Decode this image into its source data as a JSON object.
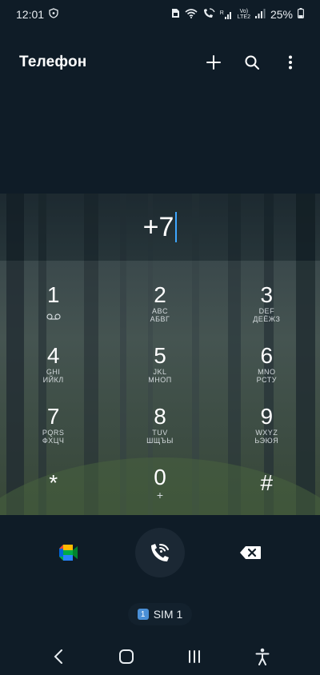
{
  "status": {
    "time": "12:01",
    "battery": "25%",
    "volte_top": "Vo)",
    "volte_bottom": "LTE2",
    "r_label": "R"
  },
  "app": {
    "title": "Телефон"
  },
  "dialer": {
    "number": "+7"
  },
  "keys": [
    {
      "digit": "1",
      "sub": ""
    },
    {
      "digit": "2",
      "sub": "ABC",
      "sub2": "АБВГ"
    },
    {
      "digit": "3",
      "sub": "DEF",
      "sub2": "ДЕЁЖЗ"
    },
    {
      "digit": "4",
      "sub": "GHI",
      "sub2": "ИЙКЛ"
    },
    {
      "digit": "5",
      "sub": "JKL",
      "sub2": "МНОП"
    },
    {
      "digit": "6",
      "sub": "MNO",
      "sub2": "РСТУ"
    },
    {
      "digit": "7",
      "sub": "PQRS",
      "sub2": "ФХЦЧ"
    },
    {
      "digit": "8",
      "sub": "TUV",
      "sub2": "ШЩЪЫ"
    },
    {
      "digit": "9",
      "sub": "WXYZ",
      "sub2": "ЬЭЮЯ"
    },
    {
      "digit": "*"
    },
    {
      "digit": "0",
      "sub": "+"
    },
    {
      "digit": "#"
    }
  ],
  "sim": {
    "badge": "1",
    "label": "SIM 1"
  },
  "colors": {
    "accent": "#3ea6ff",
    "background": "#0f1c27",
    "call_button": "#1b2834",
    "sim_badge": "#4a8fd6"
  }
}
